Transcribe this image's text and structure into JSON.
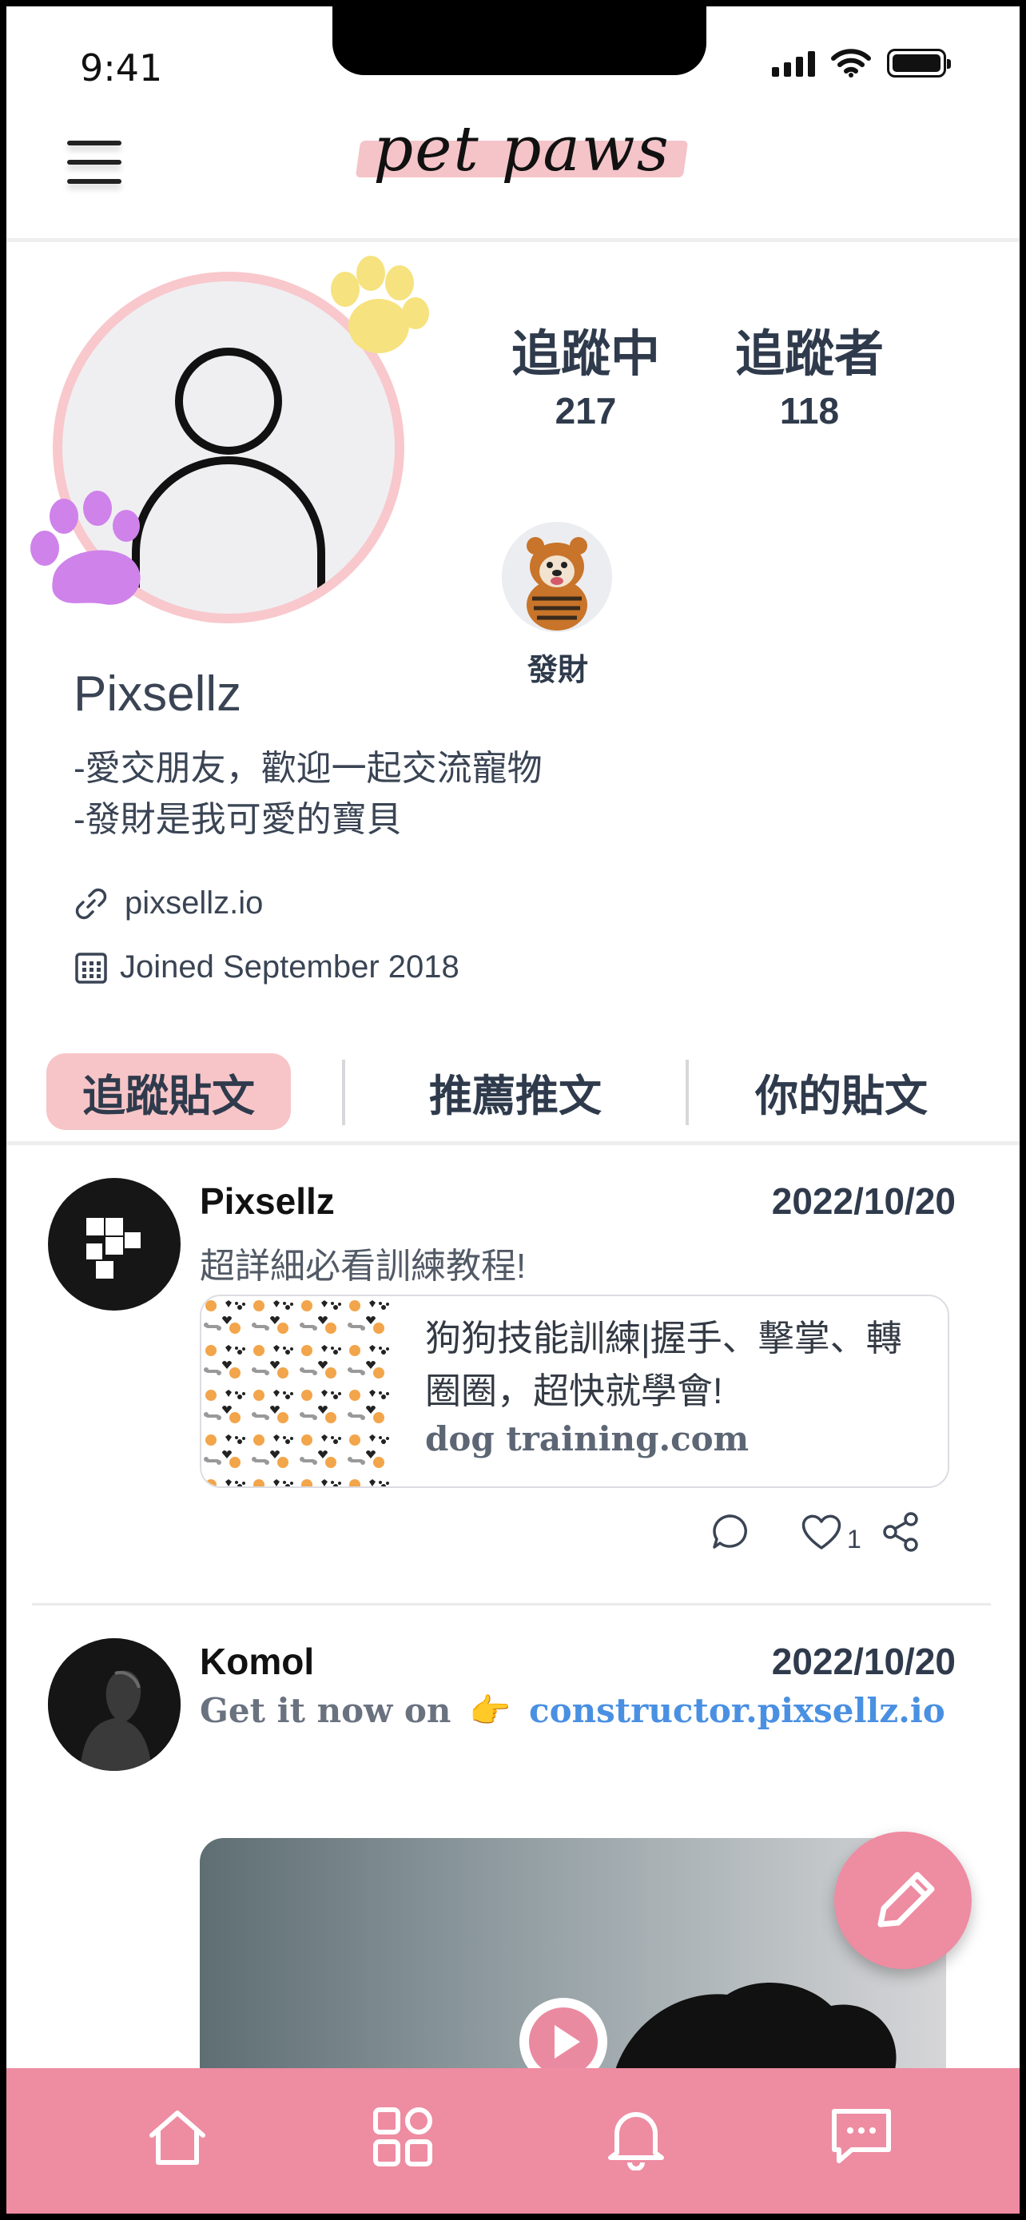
{
  "status_bar": {
    "time": "9:41"
  },
  "header": {
    "logo_text": "pet paws"
  },
  "profile": {
    "following_label": "追蹤中",
    "following_count": "217",
    "followers_label": "追蹤者",
    "followers_count": "118",
    "pet_name": "發財",
    "name": "Pixsellz",
    "bio_line1": "-愛交朋友，歡迎一起交流寵物",
    "bio_line2": "-發財是我可愛的寶貝",
    "website": "pixsellz.io",
    "joined": "Joined September 2018"
  },
  "tabs": [
    {
      "label": "追蹤貼文",
      "active": true
    },
    {
      "label": "推薦推文",
      "active": false
    },
    {
      "label": "你的貼文",
      "active": false
    }
  ],
  "posts": [
    {
      "author": "Pixsellz",
      "date": "2022/10/20",
      "text": "超詳細必看訓練教程!",
      "link_title": "狗狗技能訓練|握手、擊掌、轉圈圈，超快就學會!",
      "link_domain": "dog training.com",
      "like_count": "1"
    },
    {
      "author": "Komol",
      "date": "2022/10/20",
      "text_prefix": "Get it now on",
      "emoji": "👉",
      "link": "constructor.pixsellz.io"
    }
  ],
  "colors": {
    "accent_pink": "#ee8ca2",
    "tab_active": "#f7c5c8",
    "text_dark": "#2f3b4c",
    "link_blue": "#4a90e2"
  },
  "icons": {
    "menu": "hamburger-icon",
    "website": "link-icon",
    "joined": "calendar-icon",
    "comment": "comment-icon",
    "like": "heart-icon",
    "share": "share-icon",
    "compose": "pencil-icon",
    "nav": [
      "home-icon",
      "grid-icon",
      "bell-icon",
      "message-icon"
    ]
  }
}
